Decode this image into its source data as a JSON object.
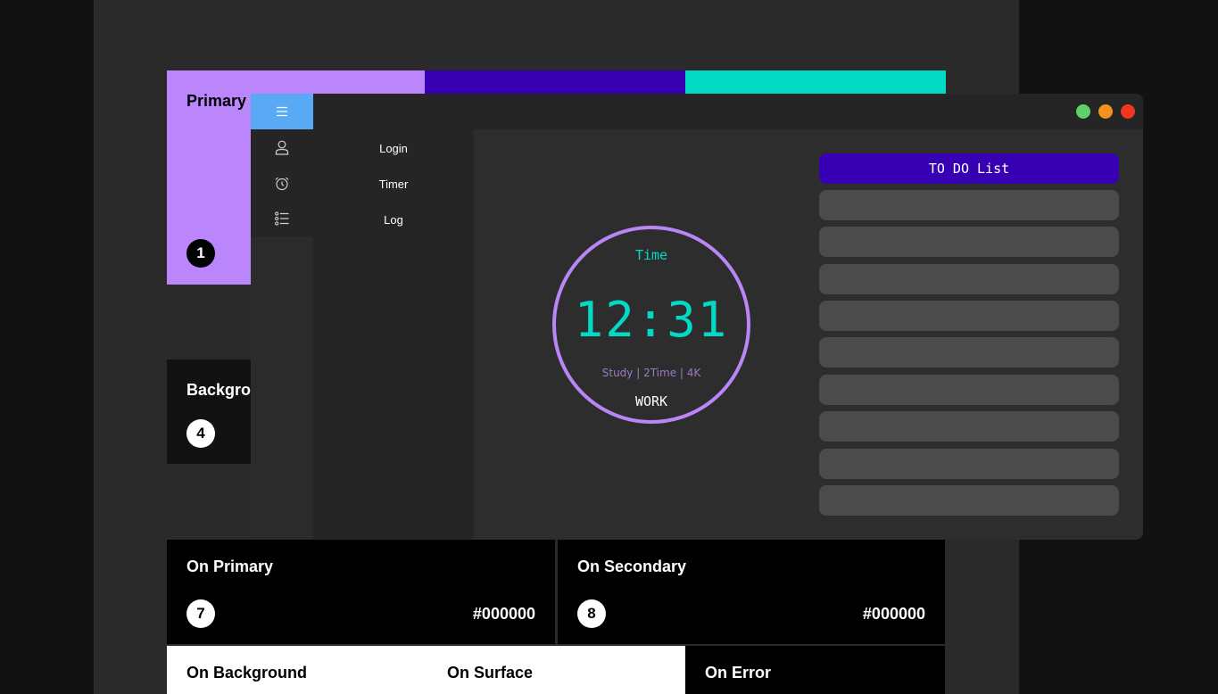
{
  "palette": {
    "primary": {
      "label": "Primary",
      "number": "1",
      "color": "#bb86fc"
    },
    "primary_variant": {
      "color": "#3700b3"
    },
    "secondary": {
      "color": "#03dac6"
    },
    "background": {
      "label": "Background",
      "number": "4",
      "color": "#121212"
    },
    "on_primary": {
      "label": "On Primary",
      "number": "7",
      "hex": "#000000"
    },
    "on_secondary": {
      "label": "On Secondary",
      "number": "8",
      "hex": "#000000"
    },
    "on_background": {
      "label": "On Background"
    },
    "on_surface": {
      "label": "On Surface"
    },
    "on_error": {
      "label": "On Error"
    }
  },
  "window": {
    "traffic_lights": [
      "#5fcf6a",
      "#f5921e",
      "#f0381e"
    ]
  },
  "sidebar": {
    "icons": [
      "menu-icon",
      "user-icon",
      "alarm-clock-icon",
      "list-icon"
    ],
    "items": [
      {
        "label": "Login"
      },
      {
        "label": "Timer"
      },
      {
        "label": "Log"
      }
    ]
  },
  "timer": {
    "caption": "Time",
    "value": "12:31",
    "subtitle": "Study | 2Time | 4K",
    "mode": "WORK"
  },
  "todo": {
    "title": "TO DO List",
    "items": [
      "",
      "",
      "",
      "",
      "",
      "",
      "",
      "",
      ""
    ]
  }
}
